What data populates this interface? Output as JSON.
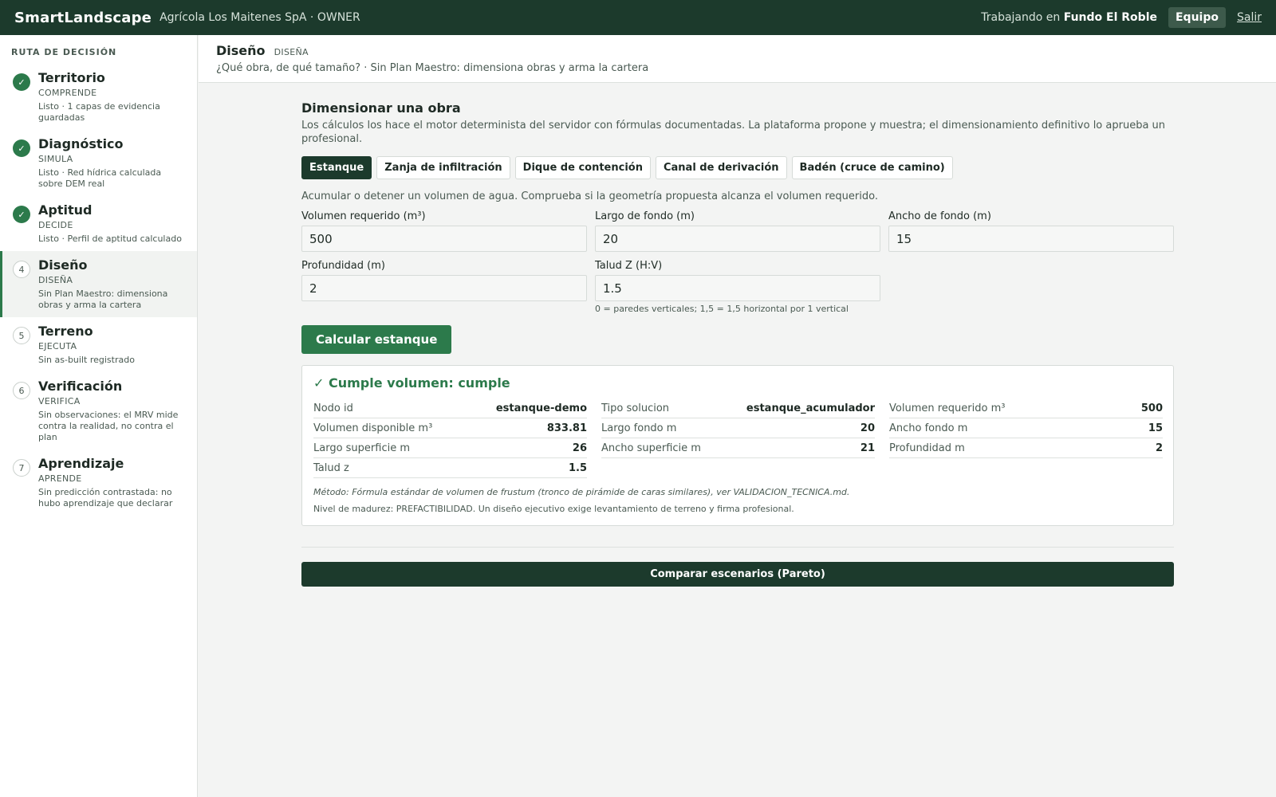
{
  "topbar": {
    "brand": "SmartLandscape",
    "org": "Agrícola Los Maitenes SpA · OWNER",
    "working_prefix": "Trabajando en",
    "working_farm": "Fundo El Roble",
    "team_label": "Equipo",
    "logout_label": "Salir"
  },
  "sidebar": {
    "title": "RUTA DE DECISIÓN",
    "steps": [
      {
        "badge": "✓",
        "name": "Territorio",
        "phase": "COMPRENDE",
        "status": "Listo · 1 capas de evidencia guardadas"
      },
      {
        "badge": "✓",
        "name": "Diagnóstico",
        "phase": "SIMULA",
        "status": "Listo · Red hídrica calculada sobre DEM real"
      },
      {
        "badge": "✓",
        "name": "Aptitud",
        "phase": "DECIDE",
        "status": "Listo · Perfil de aptitud calculado"
      },
      {
        "badge": "4",
        "name": "Diseño",
        "phase": "DISEÑA",
        "status": "Sin Plan Maestro: dimensiona obras y arma la cartera"
      },
      {
        "badge": "5",
        "name": "Terreno",
        "phase": "EJECUTA",
        "status": "Sin as-built registrado"
      },
      {
        "badge": "6",
        "name": "Verificación",
        "phase": "VERIFICA",
        "status": "Sin observaciones: el MRV mide contra la realidad, no contra el plan"
      },
      {
        "badge": "7",
        "name": "Aprendizaje",
        "phase": "APRENDE",
        "status": "Sin predicción contrastada: no hubo aprendizaje que declarar"
      }
    ]
  },
  "header": {
    "title": "Diseño",
    "tag": "DISEÑA",
    "subtitle": "¿Qué obra, de qué tamaño? · Sin Plan Maestro: dimensiona obras y arma la cartera"
  },
  "section": {
    "title": "Dimensionar una obra",
    "description": "Los cálculos los hace el motor determinista del servidor con fórmulas documentadas. La plataforma propone y muestra; el dimensionamiento definitivo lo aprueba un profesional."
  },
  "tabs": [
    "Estanque",
    "Zanja de infiltración",
    "Dique de contención",
    "Canal de derivación",
    "Badén (cruce de camino)"
  ],
  "tab_description": "Acumular o detener un volumen de agua. Comprueba si la geometría propuesta alcanza el volumen requerido.",
  "form": {
    "volumen_label": "Volumen requerido (m³)",
    "volumen_value": "500",
    "largo_label": "Largo de fondo (m)",
    "largo_value": "20",
    "ancho_label": "Ancho de fondo (m)",
    "ancho_value": "15",
    "profundidad_label": "Profundidad (m)",
    "profundidad_value": "2",
    "talud_label": "Talud Z (H:V)",
    "talud_value": "1.5",
    "talud_hint": "0 = paredes verticales; 1,5 = 1,5 horizontal por 1 vertical",
    "calc_label": "Calcular estanque"
  },
  "result": {
    "heading": "✓ Cumple volumen: cumple",
    "rows": [
      {
        "k": "Nodo id",
        "v": "estanque-demo"
      },
      {
        "k": "Tipo solucion",
        "v": "estanque_acumulador"
      },
      {
        "k": "Volumen requerido m³",
        "v": "500"
      },
      {
        "k": "Volumen disponible m³",
        "v": "833.81"
      },
      {
        "k": "Largo fondo m",
        "v": "20"
      },
      {
        "k": "Ancho fondo m",
        "v": "15"
      },
      {
        "k": "Largo superficie m",
        "v": "26"
      },
      {
        "k": "Ancho superficie m",
        "v": "21"
      },
      {
        "k": "Profundidad m",
        "v": "2"
      },
      {
        "k": "Talud z",
        "v": "1.5"
      }
    ],
    "method": "Método: Fórmula estándar de volumen de frustum (tronco de pirámide de caras similares), ver VALIDACION_TECNICA.md.",
    "maturity": "Nivel de madurez: PREFACTIBILIDAD. Un diseño ejecutivo exige levantamiento de terreno y firma profesional."
  },
  "compare_label": "Comparar escenarios (Pareto)",
  "colors": {
    "primary": "#1c3a2c",
    "accent": "#2c7a4b"
  }
}
